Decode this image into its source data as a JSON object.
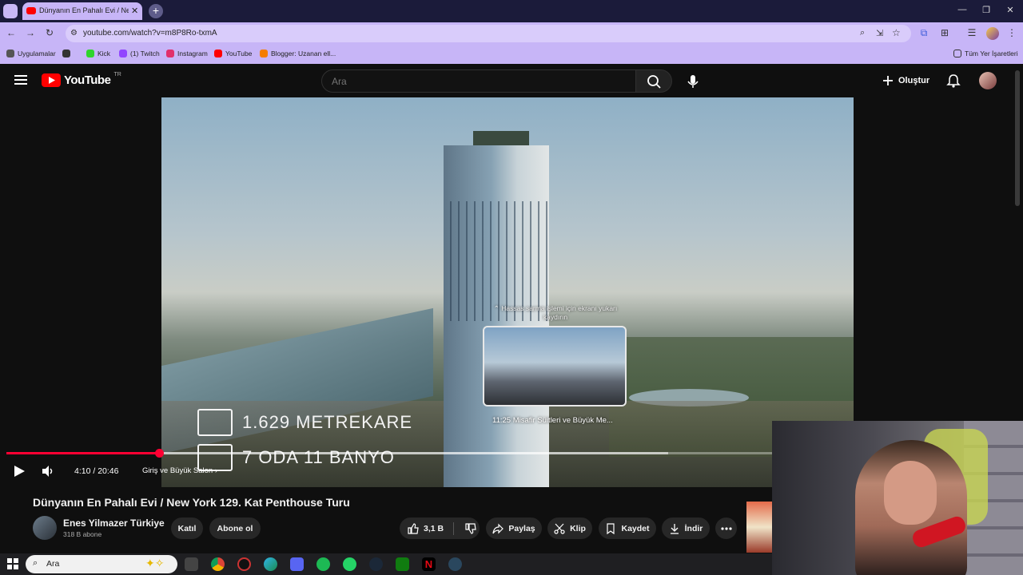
{
  "browser": {
    "tab_title": "Dünyanın En Pahalı Evi / New Y",
    "tab_close": "✕",
    "new_tab": "+",
    "url": "youtube.com/watch?v=m8P8Ro-txmA",
    "window_controls": [
      "—",
      "❐",
      "✕"
    ]
  },
  "bookmarks": {
    "items": [
      "Uygulamalar",
      "Kick",
      "(1) Twitch",
      "Instagram",
      "YouTube",
      "Blogger: Uzanan ell..."
    ],
    "all_bookmarks": "Tüm Yer İşaretleri"
  },
  "youtube": {
    "logo_text": "YouTube",
    "region": "TR",
    "search_placeholder": "Ara",
    "create_label": "Oluştur"
  },
  "video": {
    "stat1": "1.629 METREKARE",
    "stat2": "7 ODA 11 BANYO",
    "scrub_hint": "⌃ Hassas sarma işlemi için ekranı yukarı kaydırın",
    "preview_label": "11:25  Misafir Süitleri ve Büyük Me...",
    "time": "4:10 / 20:46",
    "chapter": "Giriş ve Büyük Salon ›",
    "progress": 0.2
  },
  "meta": {
    "title": "Dünyanın En Pahalı Evi / New York 129. Kat Penthouse Turu",
    "channel": "Enes Yilmazer Türkiye",
    "subscribers": "318 B abone",
    "join": "Katıl",
    "subscribe": "Abone ol",
    "likes": "3,1 B",
    "share": "Paylaş",
    "clip": "Klip",
    "save": "Kaydet",
    "download": "İndir"
  },
  "taskbar": {
    "search_text": "Ara"
  }
}
